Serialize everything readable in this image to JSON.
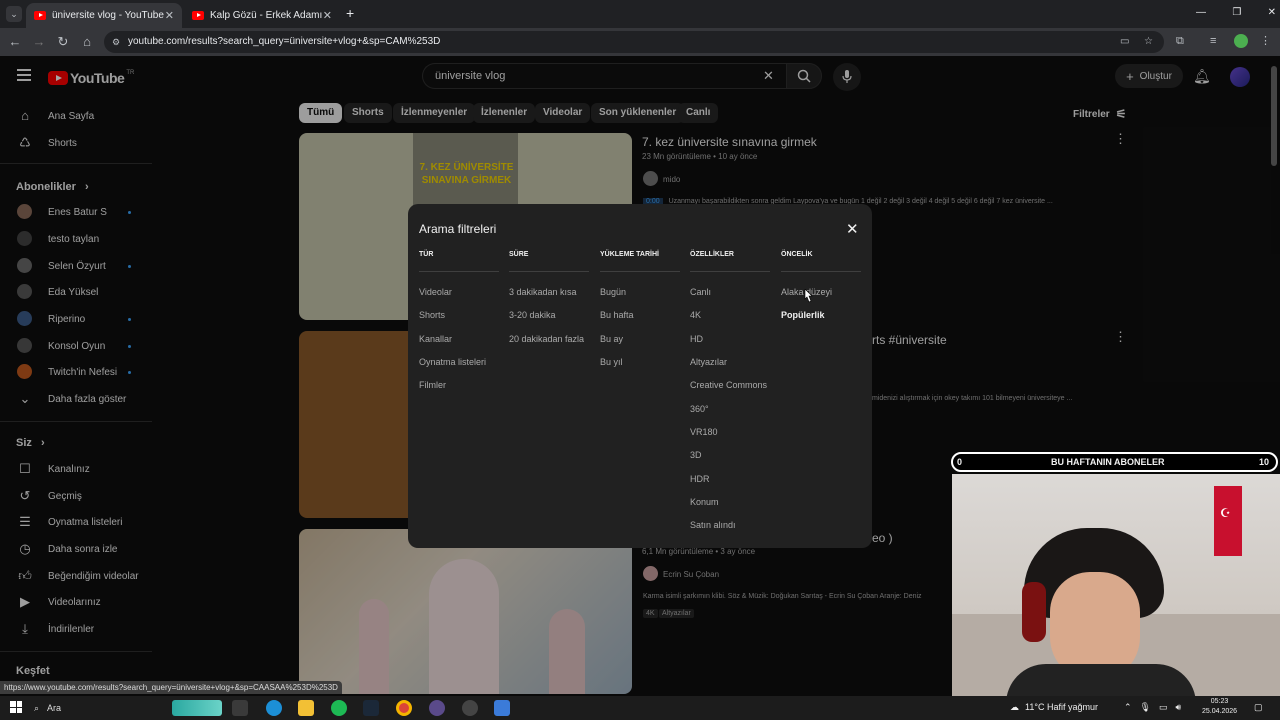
{
  "browser": {
    "tabs": [
      {
        "title": "üniversite vlog - YouTube",
        "active": true
      },
      {
        "title": "Kalp Gözü - Erkek Adamın Erke",
        "active": false
      }
    ],
    "new_tab": "+",
    "url": "youtube.com/results?search_query=üniversite+vlog+&sp=CAM%253D"
  },
  "header": {
    "logo_text": "YouTube",
    "logo_sup": "TR",
    "search_value": "üniversite vlog",
    "create_label": "Oluştur"
  },
  "sidebar": {
    "main": [
      {
        "label": "Ana Sayfa",
        "icon": "home-icon"
      },
      {
        "label": "Shorts",
        "icon": "shorts-icon"
      }
    ],
    "subs_heading": "Abonelikler",
    "subs": [
      {
        "label": "Enes Batur S",
        "dot": true,
        "color": "#8a6a5a"
      },
      {
        "label": "testo taylan",
        "dot": false,
        "color": "#444444"
      },
      {
        "label": "Selen Özyurt",
        "dot": true,
        "color": "#6b6b6b"
      },
      {
        "label": "Eda Yüksel",
        "dot": false,
        "color": "#5a5a5a"
      },
      {
        "label": "Riperino",
        "dot": true,
        "color": "#3d5d8a"
      },
      {
        "label": "Konsol Oyun",
        "dot": true,
        "color": "#555555"
      },
      {
        "label": "Twitch'in Nefesi",
        "dot": true,
        "color": "#c25a1e"
      }
    ],
    "show_more": "Daha fazla göster",
    "you_heading": "Siz",
    "you": [
      {
        "label": "Kanalınız",
        "icon": "channel-icon"
      },
      {
        "label": "Geçmiş",
        "icon": "history-icon"
      },
      {
        "label": "Oynatma listeleri",
        "icon": "playlists-icon"
      },
      {
        "label": "Daha sonra izle",
        "icon": "watch-later-icon"
      },
      {
        "label": "Beğendiğim videolar",
        "icon": "like-icon"
      },
      {
        "label": "Videolarınız",
        "icon": "your-videos-icon"
      },
      {
        "label": "İndirilenler",
        "icon": "download-icon"
      }
    ],
    "explore_heading": "Keşfet"
  },
  "chips": [
    "Tümü",
    "Shorts",
    "İzlenmeyenler",
    "İzlenenler",
    "Videolar",
    "Son yüklenenler",
    "Canlı"
  ],
  "filters_label": "Filtreler",
  "results": [
    {
      "title": "7. kez üniversite sınavına girmek",
      "meta": "23 Mn görüntüleme • 10 ay önce",
      "channel": "mido",
      "snippet": "Uzanmayı başarabildikten sonra geldim Laypova'ya ve bugün 1 değil 2 değil 3 değil 4 değil 5 değil 6 değil 7 kez üniversite ...",
      "timestamp": "0:00",
      "thumb_text": "7. KEZ ÜNİVERSİTE SINAVINA GİRMEK"
    },
    {
      "title_tail": "rts #üniversite",
      "snippet_tail": "midenizi alıştırmak için okey takımı 101 bilmeyeni üniversiteye ..."
    },
    {
      "title_tail": "eo )",
      "meta": "6,1 Mn görüntüleme • 3 ay önce",
      "channel": "Ecrin Su Çoban",
      "snippet": "Karma isimli şarkımın klibi. Söz & Müzik: Doğukan Sarıtaş - Ecrin Su Çoban Aranje: Deniz",
      "badges": [
        "4K",
        "Altyazılar"
      ]
    }
  ],
  "dialog": {
    "title": "Arama filtreleri",
    "columns": [
      {
        "heading": "TÜR",
        "options": [
          "Videolar",
          "Shorts",
          "Kanallar",
          "Oynatma listeleri",
          "Filmler"
        ]
      },
      {
        "heading": "SÜRE",
        "options": [
          "3 dakikadan kısa",
          "3-20 dakika",
          "20 dakikadan fazla"
        ]
      },
      {
        "heading": "YÜKLEME TARİHİ",
        "options": [
          "Bugün",
          "Bu hafta",
          "Bu ay",
          "Bu yıl"
        ]
      },
      {
        "heading": "ÖZELLİKLER",
        "options": [
          "Canlı",
          "4K",
          "HD",
          "Altyazılar",
          "Creative Commons",
          "360°",
          "VR180",
          "3D",
          "HDR",
          "Konum",
          "Satın alındı"
        ]
      },
      {
        "heading": "ÖNCELİK",
        "options": [
          "Alaka düzeyi",
          "Popülerlik"
        ],
        "selected": "Popülerlik"
      }
    ]
  },
  "subs_bar": {
    "left": "0",
    "label": "BU HAFTANIN ABONELER",
    "right": "10"
  },
  "status_url": "https://www.youtube.com/results?search_query=üniversite+vlog+&sp=CAASAA%253D%253D",
  "taskbar": {
    "search_label": "Ara",
    "weather": "11°C  Hafif yağmur",
    "time": "05:23",
    "date": "25.04.2026"
  }
}
